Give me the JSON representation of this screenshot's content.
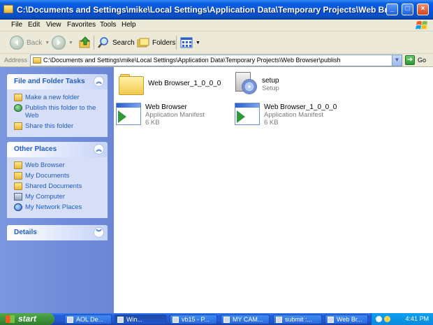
{
  "window": {
    "title": "C:\\Documents and Settings\\mike\\Local Settings\\Application Data\\Temporary Projects\\Web Browser\\p",
    "controls": {
      "minimize": "_",
      "maximize": "□",
      "close": "×"
    }
  },
  "menu": [
    "File",
    "Edit",
    "View",
    "Favorites",
    "Tools",
    "Help"
  ],
  "toolbar": {
    "back_label": "Back",
    "search_label": "Search",
    "folders_label": "Folders"
  },
  "address": {
    "label": "Address",
    "value": "C:\\Documents and Settings\\mike\\Local Settings\\Application Data\\Temporary Projects\\Web Browser\\publish",
    "go_label": "Go"
  },
  "left_panels": {
    "tasks": {
      "title": "File and Folder Tasks",
      "items": [
        "Make a new folder",
        "Publish this folder to the Web",
        "Share this folder"
      ]
    },
    "places": {
      "title": "Other Places",
      "items": [
        "Web Browser",
        "My Documents",
        "Shared Documents",
        "My Computer",
        "My Network Places"
      ]
    },
    "details": {
      "title": "Details"
    }
  },
  "files": [
    {
      "name": "Web Browser_1_0_0_0",
      "type": "",
      "size": ""
    },
    {
      "name": "setup",
      "type": "Setup",
      "size": ""
    },
    {
      "name": "Web Browser",
      "type": "Application Manifest",
      "size": "6 KB"
    },
    {
      "name": "Web Browser_1_0_0_0",
      "type": "Application Manifest",
      "size": "6 KB"
    }
  ],
  "taskbar": {
    "start_label": "start",
    "tasks": [
      "AOL De...",
      "Win...",
      "vb15 - P...",
      "MY CAM...",
      "submit :...",
      "Web Br..."
    ],
    "clock": "4:41 PM"
  }
}
